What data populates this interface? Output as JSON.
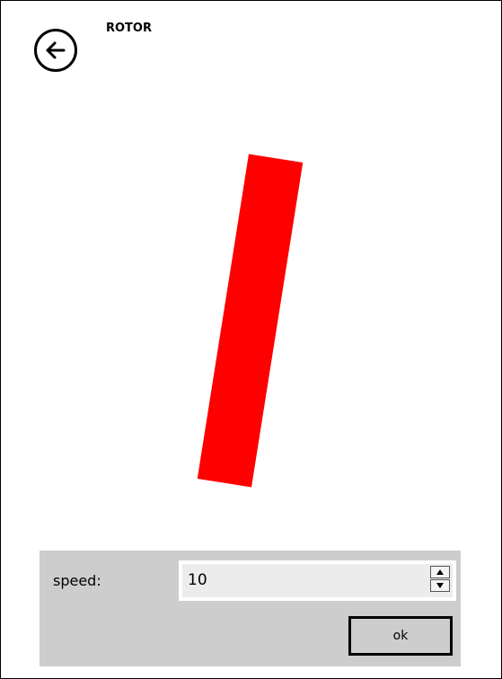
{
  "header": {
    "title": "ROTOR",
    "back_icon": "back-arrow-icon"
  },
  "rotor": {
    "color": "#ff0000",
    "angle_degrees": 9
  },
  "controls": {
    "speed_label": "speed:",
    "speed_value": "10",
    "ok_label": "ok",
    "spin_up_icon": "chevron-up-icon",
    "spin_down_icon": "chevron-down-icon"
  },
  "colors": {
    "panel_background": "#cdcdcd",
    "field_background": "#ececec"
  }
}
